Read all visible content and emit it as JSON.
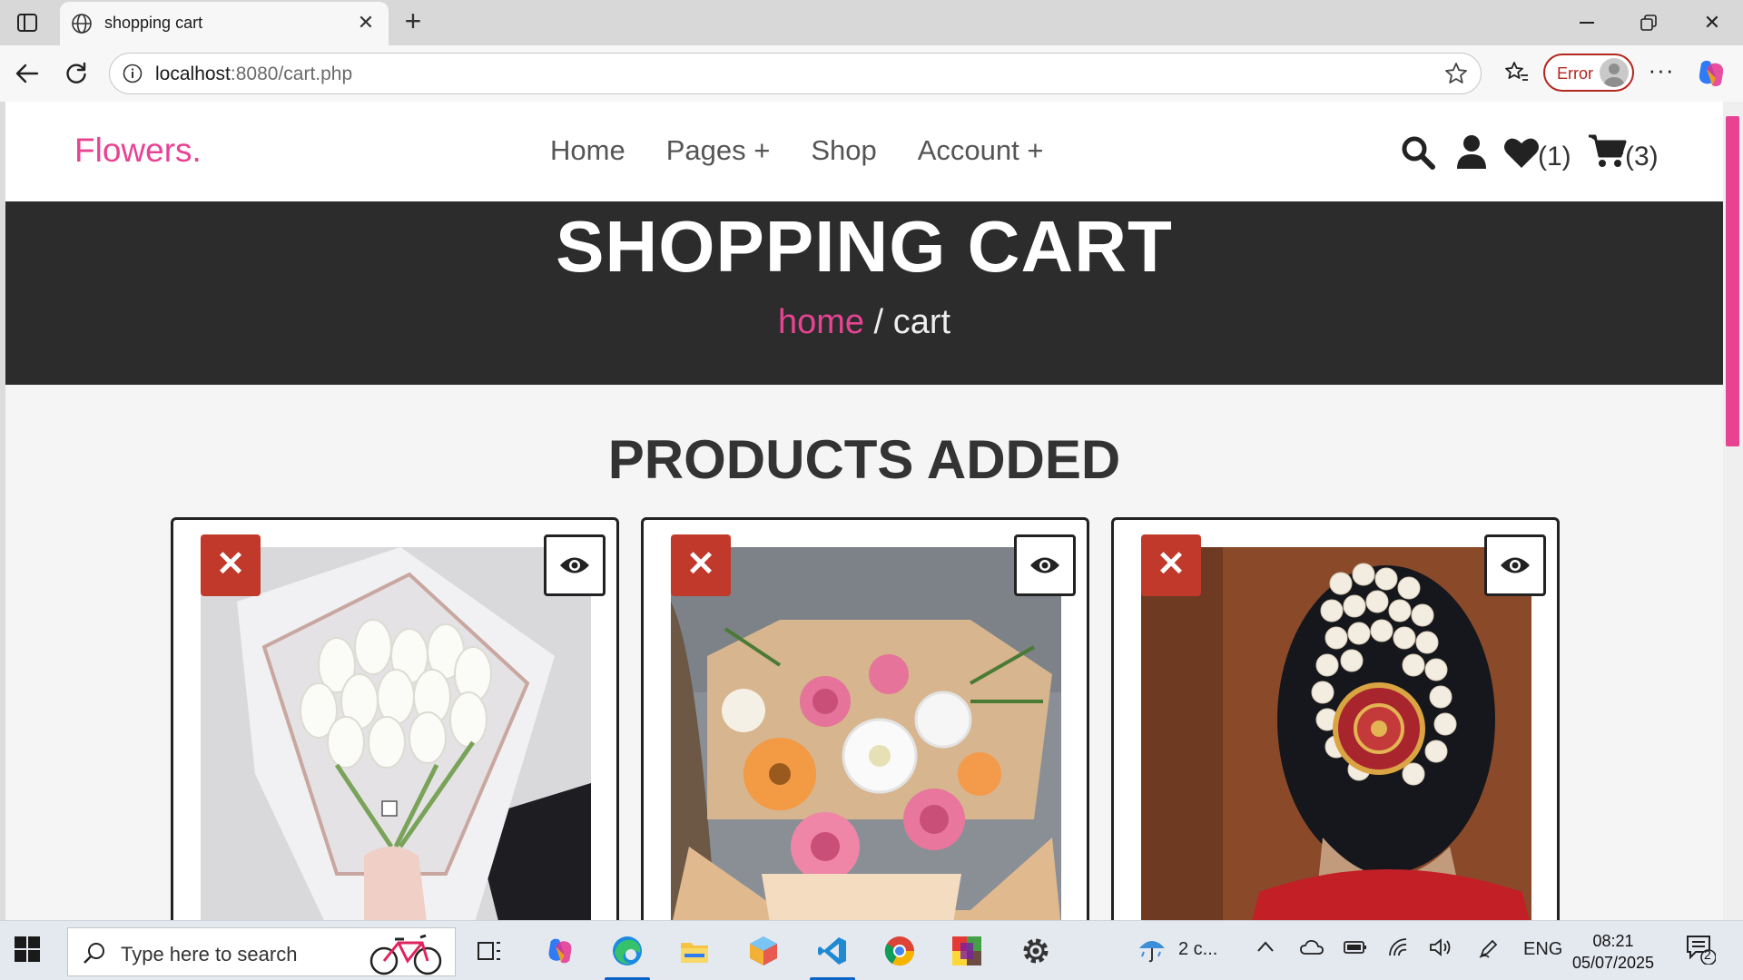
{
  "browser": {
    "tab_title": "shopping cart",
    "url_host": "localhost",
    "url_path": ":8080/cart.php",
    "profile_status": "Error"
  },
  "site": {
    "logo": "Flowers.",
    "nav": [
      "Home",
      "Pages +",
      "Shop",
      "Account +"
    ],
    "wishlist_count": "(1)",
    "cart_count": "(3)",
    "accent_color": "#e84393"
  },
  "banner": {
    "title": "SHOPPING CART",
    "crumb_home": "home",
    "crumb_sep": " / ",
    "crumb_current": "cart"
  },
  "section": {
    "title": "PRODUCTS ADDED"
  },
  "products": [
    {
      "image": "white-tulip-bouquet"
    },
    {
      "image": "mixed-rose-gerbera-bouquet"
    },
    {
      "image": "jasmine-hair-bun-decoration"
    }
  ],
  "taskbar": {
    "search_placeholder": "Type here to search",
    "weather": "2 c...",
    "language": "ENG",
    "time": "08:21",
    "date": "05/07/2025",
    "notification_count": "2"
  }
}
